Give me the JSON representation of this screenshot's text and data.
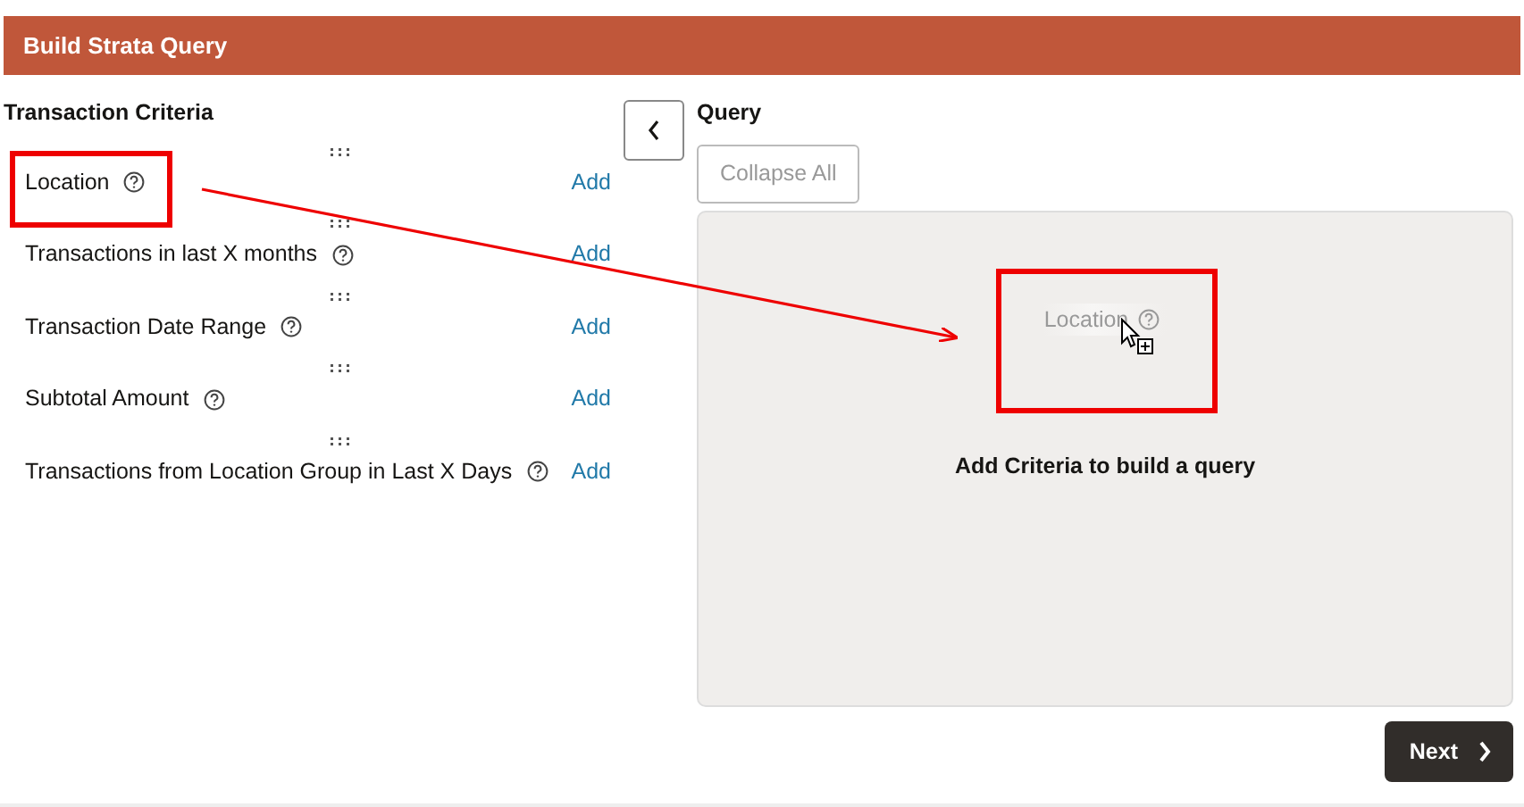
{
  "header": {
    "title": "Build Strata Query"
  },
  "criteria": {
    "title": "Transaction Criteria",
    "items": [
      {
        "label": "Location",
        "action": "Add"
      },
      {
        "label": "Transactions in last X months",
        "action": "Add"
      },
      {
        "label": "Transaction Date Range",
        "action": "Add"
      },
      {
        "label": "Subtotal Amount",
        "action": "Add"
      },
      {
        "label": "Transactions from Location Group in Last X Days",
        "action": "Add"
      }
    ]
  },
  "query": {
    "title": "Query",
    "collapse_button": "Collapse All",
    "collapse_disabled": true,
    "drag_ghost": "Location",
    "empty_message": "Add Criteria to build a query"
  },
  "footer": {
    "next_button": "Next"
  },
  "annotations": [
    {
      "kind": "highlight"
    },
    {
      "kind": "highlight"
    },
    {
      "kind": "arrow"
    }
  ]
}
